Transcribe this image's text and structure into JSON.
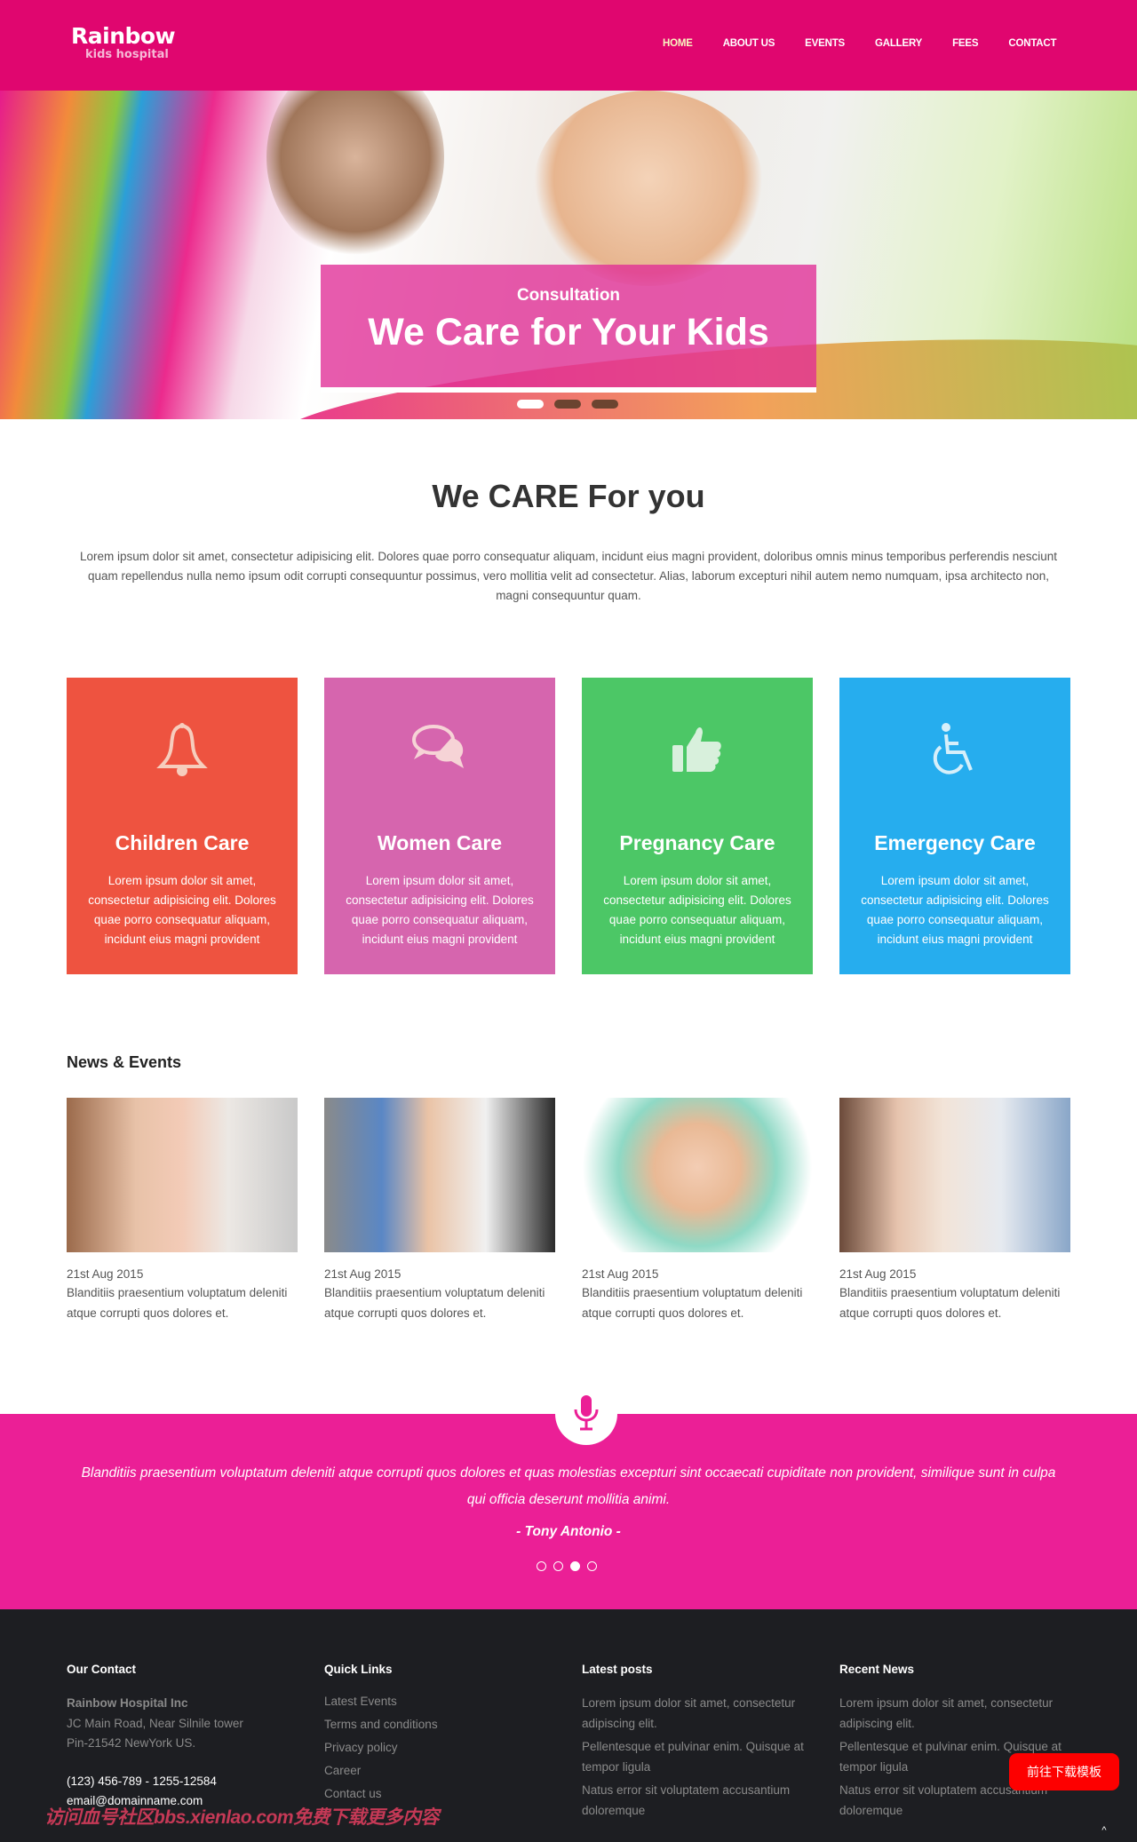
{
  "header": {
    "logo_main": "Rainbow",
    "logo_sub": "kids hospital",
    "nav": [
      "HOME",
      "ABOUT US",
      "EVENTS",
      "GALLERY",
      "FEES",
      "CONTACT"
    ],
    "active": "HOME"
  },
  "hero": {
    "subtitle": "Consultation",
    "title": "We Care for Your Kids",
    "slide_count": 3,
    "active_slide": 1
  },
  "intro": {
    "title": "We CARE For you",
    "text": "Lorem ipsum dolor sit amet, consectetur adipisicing elit. Dolores quae porro consequatur aliquam, incidunt eius magni provident, doloribus omnis minus temporibus perferendis nesciunt quam repellendus nulla nemo ipsum odit corrupti consequuntur possimus, vero mollitia velit ad consectetur. Alias, laborum excepturi nihil autem nemo numquam, ipsa architecto non, magni consequuntur quam."
  },
  "services": [
    {
      "title": "Children Care",
      "icon": "bell-icon",
      "color": "#ee5340",
      "text": "Lorem ipsum dolor sit amet, consectetur adipisicing elit. Dolores quae porro consequatur aliquam, incidunt eius magni provident"
    },
    {
      "title": "Women Care",
      "icon": "chat-bubbles-icon",
      "color": "#d665ae",
      "text": "Lorem ipsum dolor sit amet, consectetur adipisicing elit. Dolores quae porro consequatur aliquam, incidunt eius magni provident"
    },
    {
      "title": "Pregnancy Care",
      "icon": "thumbs-up-icon",
      "color": "#4cc766",
      "text": "Lorem ipsum dolor sit amet, consectetur adipisicing elit. Dolores quae porro consequatur aliquam, incidunt eius magni provident"
    },
    {
      "title": "Emergency Care",
      "icon": "wheelchair-icon",
      "color": "#26adee",
      "text": "Lorem ipsum dolor sit amet, consectetur adipisicing elit. Dolores quae porro consequatur aliquam, incidunt eius magni provident"
    }
  ],
  "news": {
    "title": "News & Events",
    "items": [
      {
        "date": "21st Aug 2015",
        "text": "Blanditiis praesentium voluptatum deleniti atque corrupti quos dolores et."
      },
      {
        "date": "21st Aug 2015",
        "text": "Blanditiis praesentium voluptatum deleniti atque corrupti quos dolores et."
      },
      {
        "date": "21st Aug 2015",
        "text": "Blanditiis praesentium voluptatum deleniti atque corrupti quos dolores et."
      },
      {
        "date": "21st Aug 2015",
        "text": "Blanditiis praesentium voluptatum deleniti atque corrupti quos dolores et."
      }
    ]
  },
  "testimonial": {
    "quote": "Blanditiis praesentium voluptatum deleniti atque corrupti quos dolores et quas molestias excepturi sint occaecati cupiditate non provident, similique sunt in culpa qui officia deserunt mollitia animi.",
    "author": "- Tony Antonio -",
    "slide_count": 4,
    "active_slide": 3
  },
  "footer": {
    "contact": {
      "title": "Our Contact",
      "name": "Rainbow Hospital Inc",
      "address1": "JC Main Road, Near Silnile tower",
      "address2": "Pin-21542 NewYork US.",
      "phone": "(123) 456-789 - 1255-12584",
      "email": "email@domainname.com"
    },
    "quick_links": {
      "title": "Quick Links",
      "items": [
        "Latest Events",
        "Terms and conditions",
        "Privacy policy",
        "Career",
        "Contact us"
      ]
    },
    "latest_posts": {
      "title": "Latest posts",
      "items": [
        "Lorem ipsum dolor sit amet, consectetur adipiscing elit.",
        "Pellentesque et pulvinar enim. Quisque at tempor ligula",
        "Natus error sit voluptatem accusantium doloremque"
      ]
    },
    "recent_news": {
      "title": "Recent News",
      "items": [
        "Lorem ipsum dolor sit amet, consectetur adipiscing elit.",
        "Pellentesque et pulvinar enim. Quisque at tempor ligula",
        "Natus error sit voluptatem accusantium doloremque"
      ]
    }
  },
  "overlay": {
    "watermark": "访问血号社区bbs.xienlao.com免费下载更多内容",
    "download_button": "前往下载模板",
    "back_to_top": "^"
  },
  "colors": {
    "brand": "#e0066f",
    "testimonial_bg": "#eb1f96",
    "footer_bg": "#1d1e22"
  }
}
